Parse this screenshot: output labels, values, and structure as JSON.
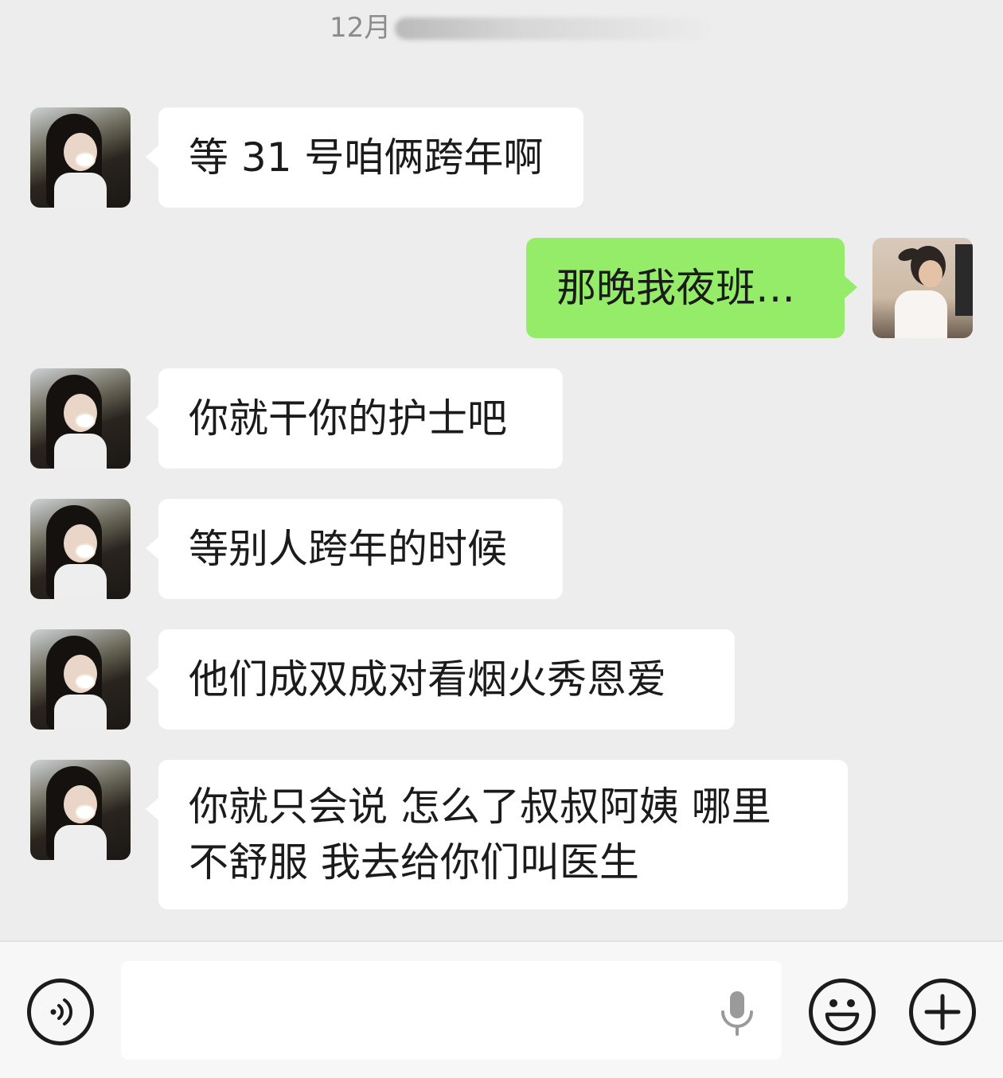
{
  "timestamp": "12月",
  "messages": [
    {
      "side": "left",
      "lines": [
        "等 31 号咱俩跨年啊"
      ]
    },
    {
      "side": "right",
      "lines": [
        "那晚我夜班…"
      ]
    },
    {
      "side": "left",
      "lines": [
        "你就干你的护士吧"
      ]
    },
    {
      "side": "left",
      "lines": [
        "等别人跨年的时候"
      ]
    },
    {
      "side": "left",
      "lines": [
        "他们成双成对看烟火秀恩爱"
      ]
    },
    {
      "side": "left",
      "lines": [
        "你就只会说  怎么了叔叔阿姨 哪里",
        "不舒服 我去给你们叫医生"
      ]
    }
  ],
  "input": {
    "value": "",
    "placeholder": ""
  },
  "icons": {
    "voice": "voice-toggle-icon",
    "mic": "microphone-icon",
    "emoji": "emoji-icon",
    "more": "plus-icon"
  },
  "colors": {
    "background": "#ededed",
    "outgoing_bubble": "#95ec69",
    "incoming_bubble": "#ffffff"
  }
}
